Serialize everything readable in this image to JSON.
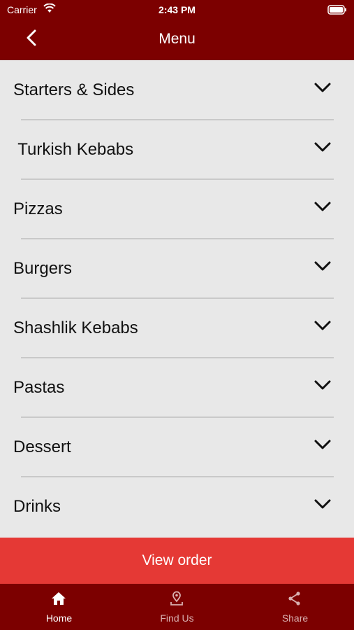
{
  "status_bar": {
    "carrier": "Carrier",
    "time": "2:43 PM"
  },
  "nav": {
    "title": "Menu"
  },
  "menu": {
    "items": [
      {
        "label": "Starters & Sides"
      },
      {
        "label": " Turkish Kebabs"
      },
      {
        "label": "Pizzas"
      },
      {
        "label": "Burgers"
      },
      {
        "label": "Shashlik Kebabs"
      },
      {
        "label": "Pastas"
      },
      {
        "label": "Dessert"
      },
      {
        "label": "Drinks"
      }
    ]
  },
  "view_order": {
    "label": "View order"
  },
  "tabbar": {
    "tabs": [
      {
        "label": "Home",
        "icon": "home-icon",
        "active": true
      },
      {
        "label": "Find Us",
        "icon": "location-pin-icon",
        "active": false
      },
      {
        "label": "Share",
        "icon": "share-icon",
        "active": false
      }
    ]
  },
  "colors": {
    "header": "#7c0000",
    "button": "#e53935",
    "background": "#e8e8e8"
  }
}
